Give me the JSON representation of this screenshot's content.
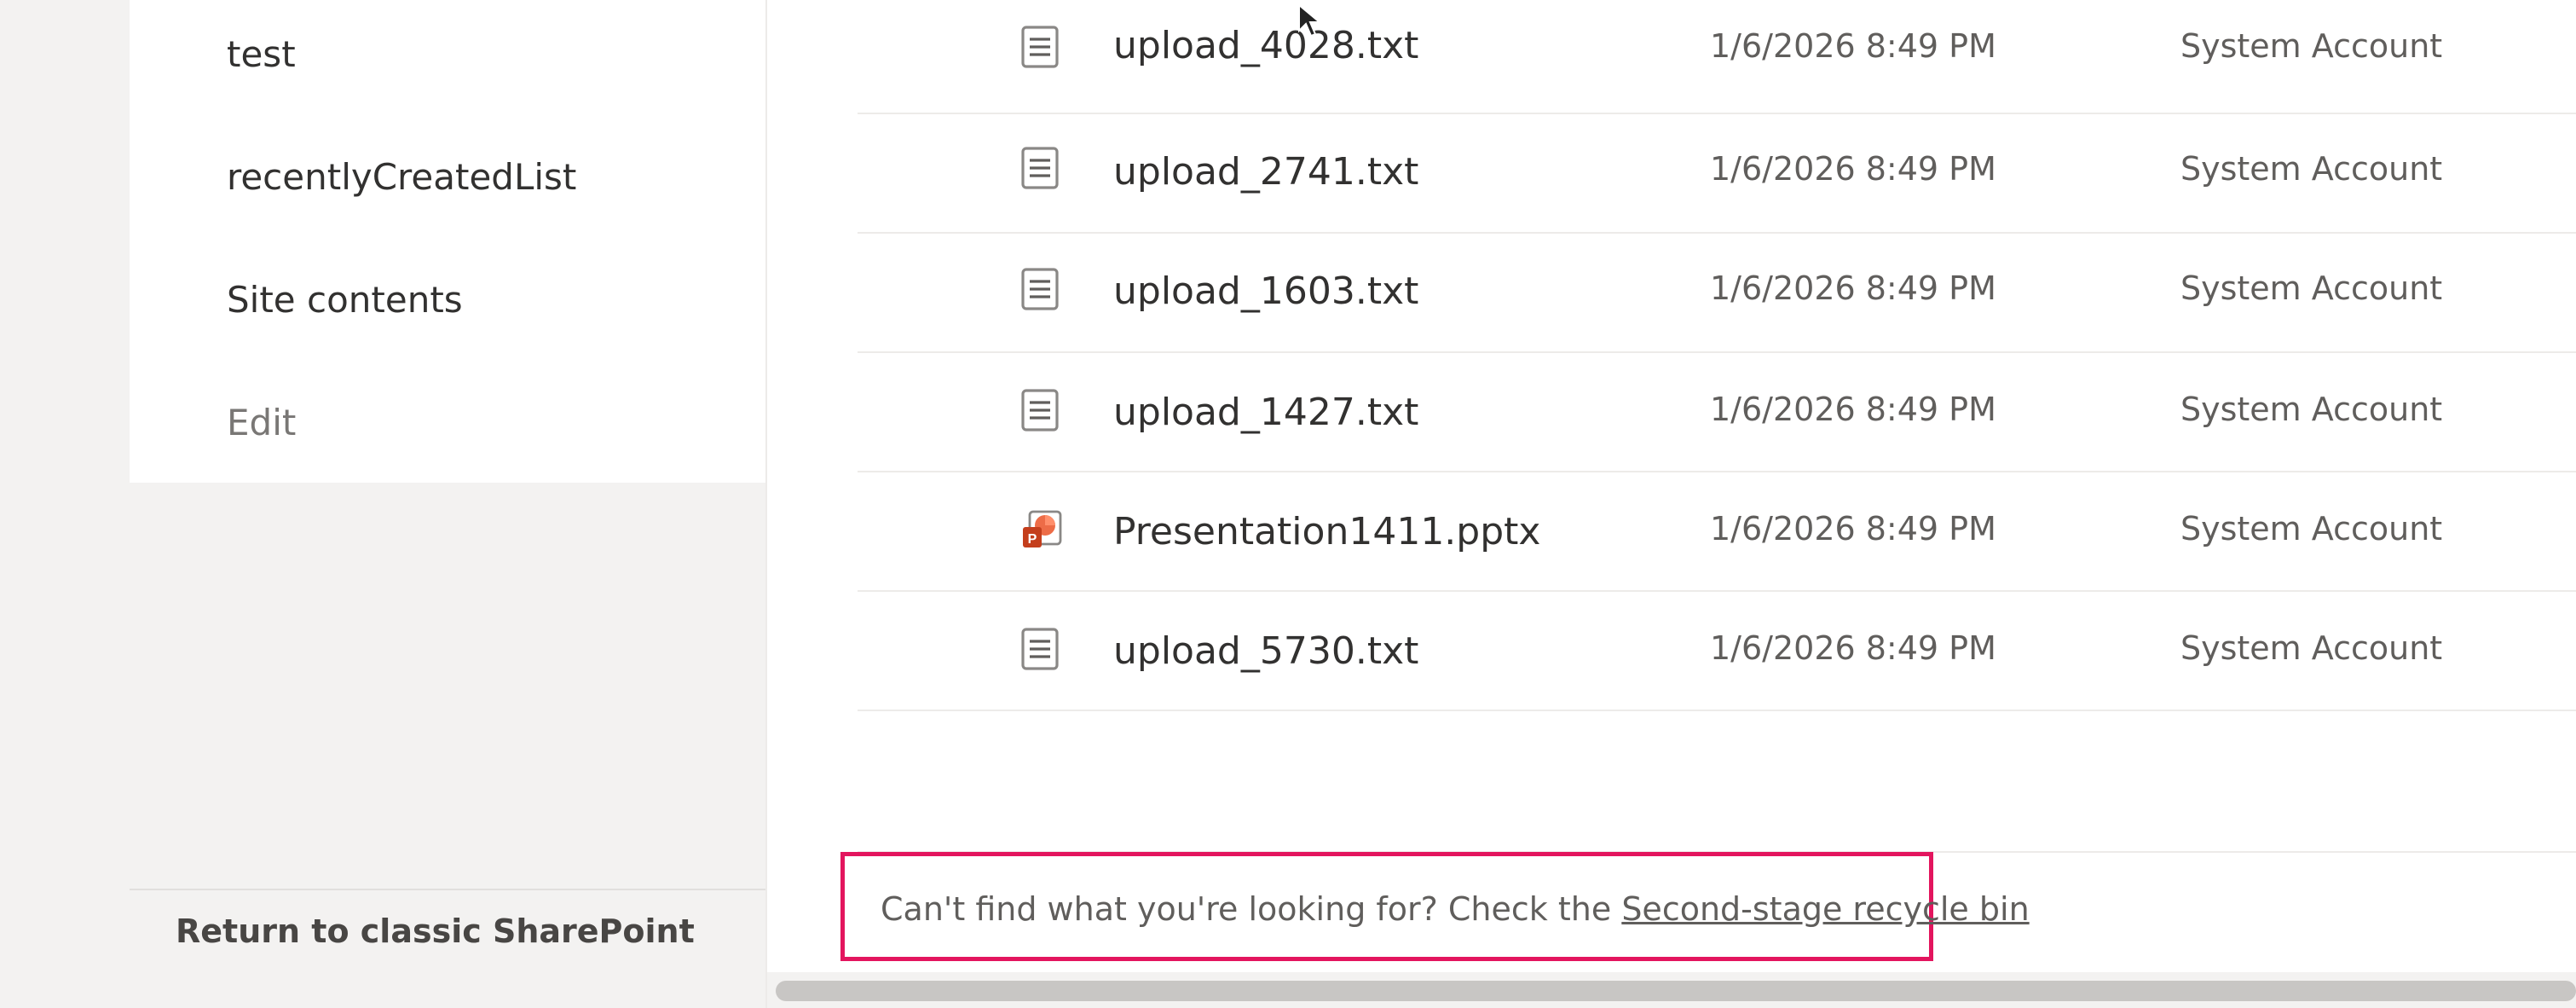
{
  "nav": {
    "items": [
      {
        "label": "test"
      },
      {
        "label": "recentlyCreatedList"
      },
      {
        "label": "Site contents"
      }
    ],
    "edit_label": "Edit",
    "return_classic": "Return to classic SharePoint"
  },
  "files": [
    {
      "name": "upload_4028.txt",
      "modified": "1/6/2026 8:49 PM",
      "modified_by": "System Account",
      "icon": "text-file-icon"
    },
    {
      "name": "upload_2741.txt",
      "modified": "1/6/2026 8:49 PM",
      "modified_by": "System Account",
      "icon": "text-file-icon"
    },
    {
      "name": "upload_1603.txt",
      "modified": "1/6/2026 8:49 PM",
      "modified_by": "System Account",
      "icon": "text-file-icon"
    },
    {
      "name": "upload_1427.txt",
      "modified": "1/6/2026 8:49 PM",
      "modified_by": "System Account",
      "icon": "text-file-icon"
    },
    {
      "name": "Presentation1411.pptx",
      "modified": "1/6/2026 8:49 PM",
      "modified_by": "System Account",
      "icon": "powerpoint-file-icon"
    },
    {
      "name": "upload_5730.txt",
      "modified": "1/6/2026 8:49 PM",
      "modified_by": "System Account",
      "icon": "text-file-icon"
    }
  ],
  "notice": {
    "text": "Can't find what you're looking for? Check the ",
    "link": "Second-stage recycle bin"
  },
  "colors": {
    "highlight_border": "#e3155e",
    "powerpoint_red": "#c43e1c"
  }
}
